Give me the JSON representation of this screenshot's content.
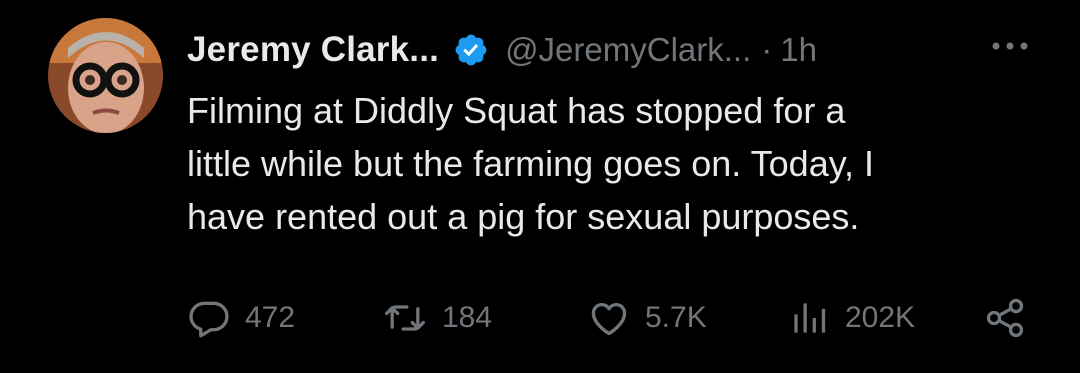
{
  "tweet": {
    "author_name": "Jeremy Clark...",
    "handle": "@JeremyClark...",
    "separator": "·",
    "time": "1h",
    "text_lines": [
      "Filming at Diddly Squat has stopped for a",
      "little while but the farming goes on. Today, I",
      "have rented out a pig for sexual purposes."
    ]
  },
  "actions": {
    "replies": "472",
    "reposts": "184",
    "likes": "5.7K",
    "views": "202K"
  },
  "icons": {
    "verified": "verified-badge-icon",
    "more": "more-icon",
    "reply": "reply-icon",
    "repost": "repost-icon",
    "like": "heart-icon",
    "views": "views-icon",
    "share": "share-icon"
  },
  "colors": {
    "background": "#000000",
    "text": "#e7e9ea",
    "muted": "#71767b",
    "verified": "#1d9bf0"
  }
}
